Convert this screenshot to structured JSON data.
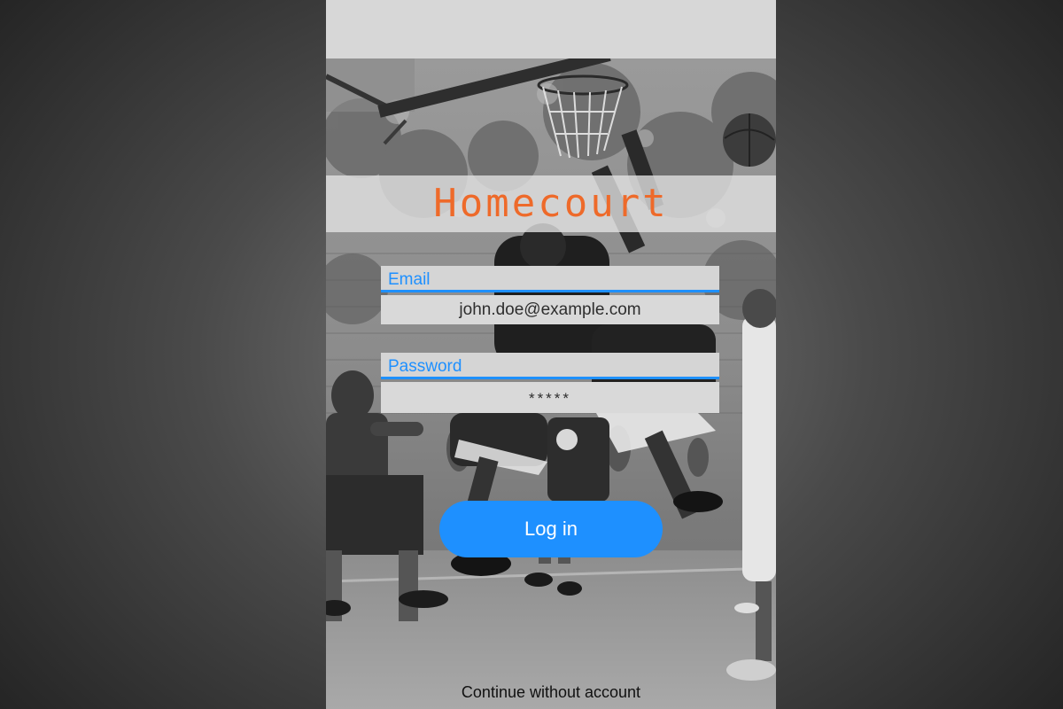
{
  "app": {
    "title": "Homecourt"
  },
  "form": {
    "email": {
      "label": "Email",
      "value": "john.doe@example.com"
    },
    "password": {
      "label": "Password",
      "value": "*****"
    }
  },
  "actions": {
    "login_label": "Log in",
    "continue_label": "Continue without account"
  },
  "colors": {
    "brand_orange": "#ee6a2a",
    "accent_blue": "#1e90ff",
    "field_bg": "#d5d5d5",
    "backdrop": "#4a4a4a"
  }
}
